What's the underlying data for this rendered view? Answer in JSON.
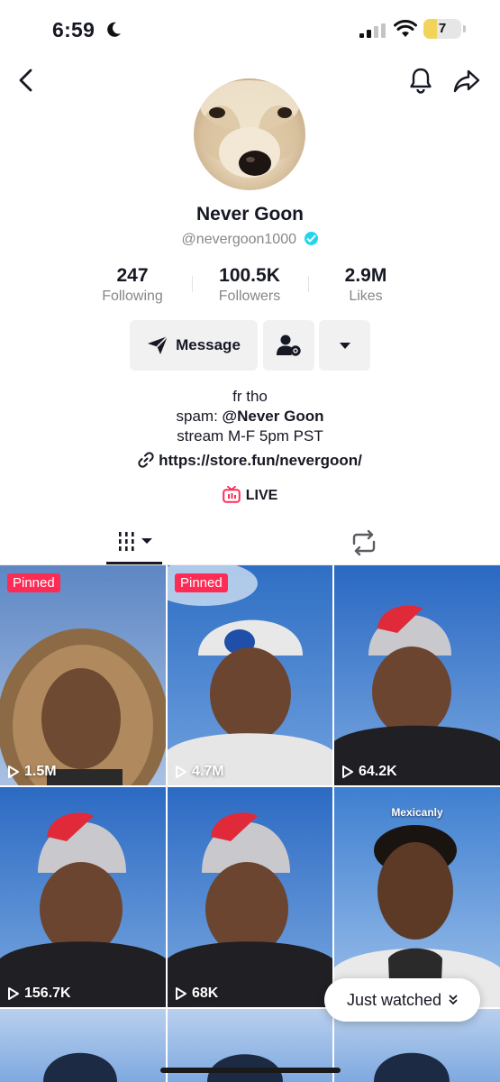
{
  "status_bar": {
    "time": "6:59",
    "battery": "7"
  },
  "profile": {
    "display_name": "Never Goon",
    "username": "@nevergoon1000",
    "verified": true
  },
  "stats": [
    {
      "value": "247",
      "label": "Following"
    },
    {
      "value": "100.5K",
      "label": "Followers"
    },
    {
      "value": "2.9M",
      "label": "Likes"
    }
  ],
  "actions": {
    "message_label": "Message"
  },
  "bio": {
    "line1": "fr tho",
    "line2_prefix": "spam: ",
    "line2_mention": "@Never Goon",
    "line3": "stream M-F 5pm PST"
  },
  "link": "https://store.fun/nevergoon/",
  "live_label": "LIVE",
  "videos": [
    {
      "pinned": "Pinned",
      "views": "1.5M"
    },
    {
      "pinned": "Pinned",
      "views": "4.7M"
    },
    {
      "views": "64.2K"
    },
    {
      "views": "156.7K"
    },
    {
      "views": "68K"
    },
    {
      "caption": "Mexicanly",
      "views": ""
    },
    {
      "views": ""
    },
    {
      "views": ""
    },
    {
      "views": ""
    }
  ],
  "just_watched_label": "Just watched",
  "colors": {
    "accent": "#fe2c55",
    "verified": "#20d5ec",
    "text": "#161823",
    "muted": "#86878b"
  }
}
